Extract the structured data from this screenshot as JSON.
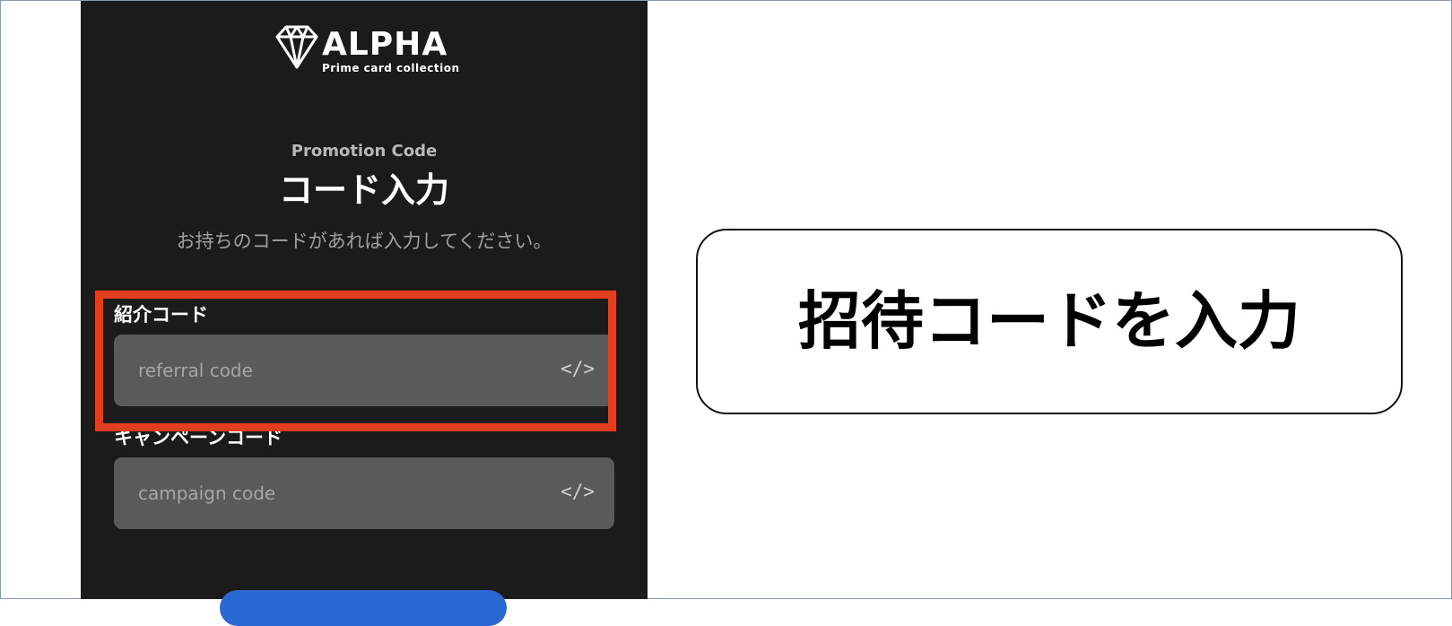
{
  "app": {
    "brand": "ALPHA",
    "tagline": "Prime card collection",
    "logo_icon": "diamond-icon"
  },
  "promotion": {
    "subtitle": "Promotion Code",
    "title": "コード入力",
    "description": "お持ちのコードがあれば入力してください。"
  },
  "referral": {
    "label": "紹介コード",
    "placeholder": "referral code",
    "icon": "code-icon",
    "icon_glyph": "</>"
  },
  "campaign": {
    "label": "キャンペーンコード",
    "placeholder": "campaign code",
    "icon": "code-icon",
    "icon_glyph": "</>"
  },
  "callout": {
    "text": "招待コードを入力"
  },
  "colors": {
    "panel_bg": "#1b1b1b",
    "field_bg": "#5a5a5a",
    "highlight": "#e23e1f",
    "button": "#2b68d3"
  }
}
